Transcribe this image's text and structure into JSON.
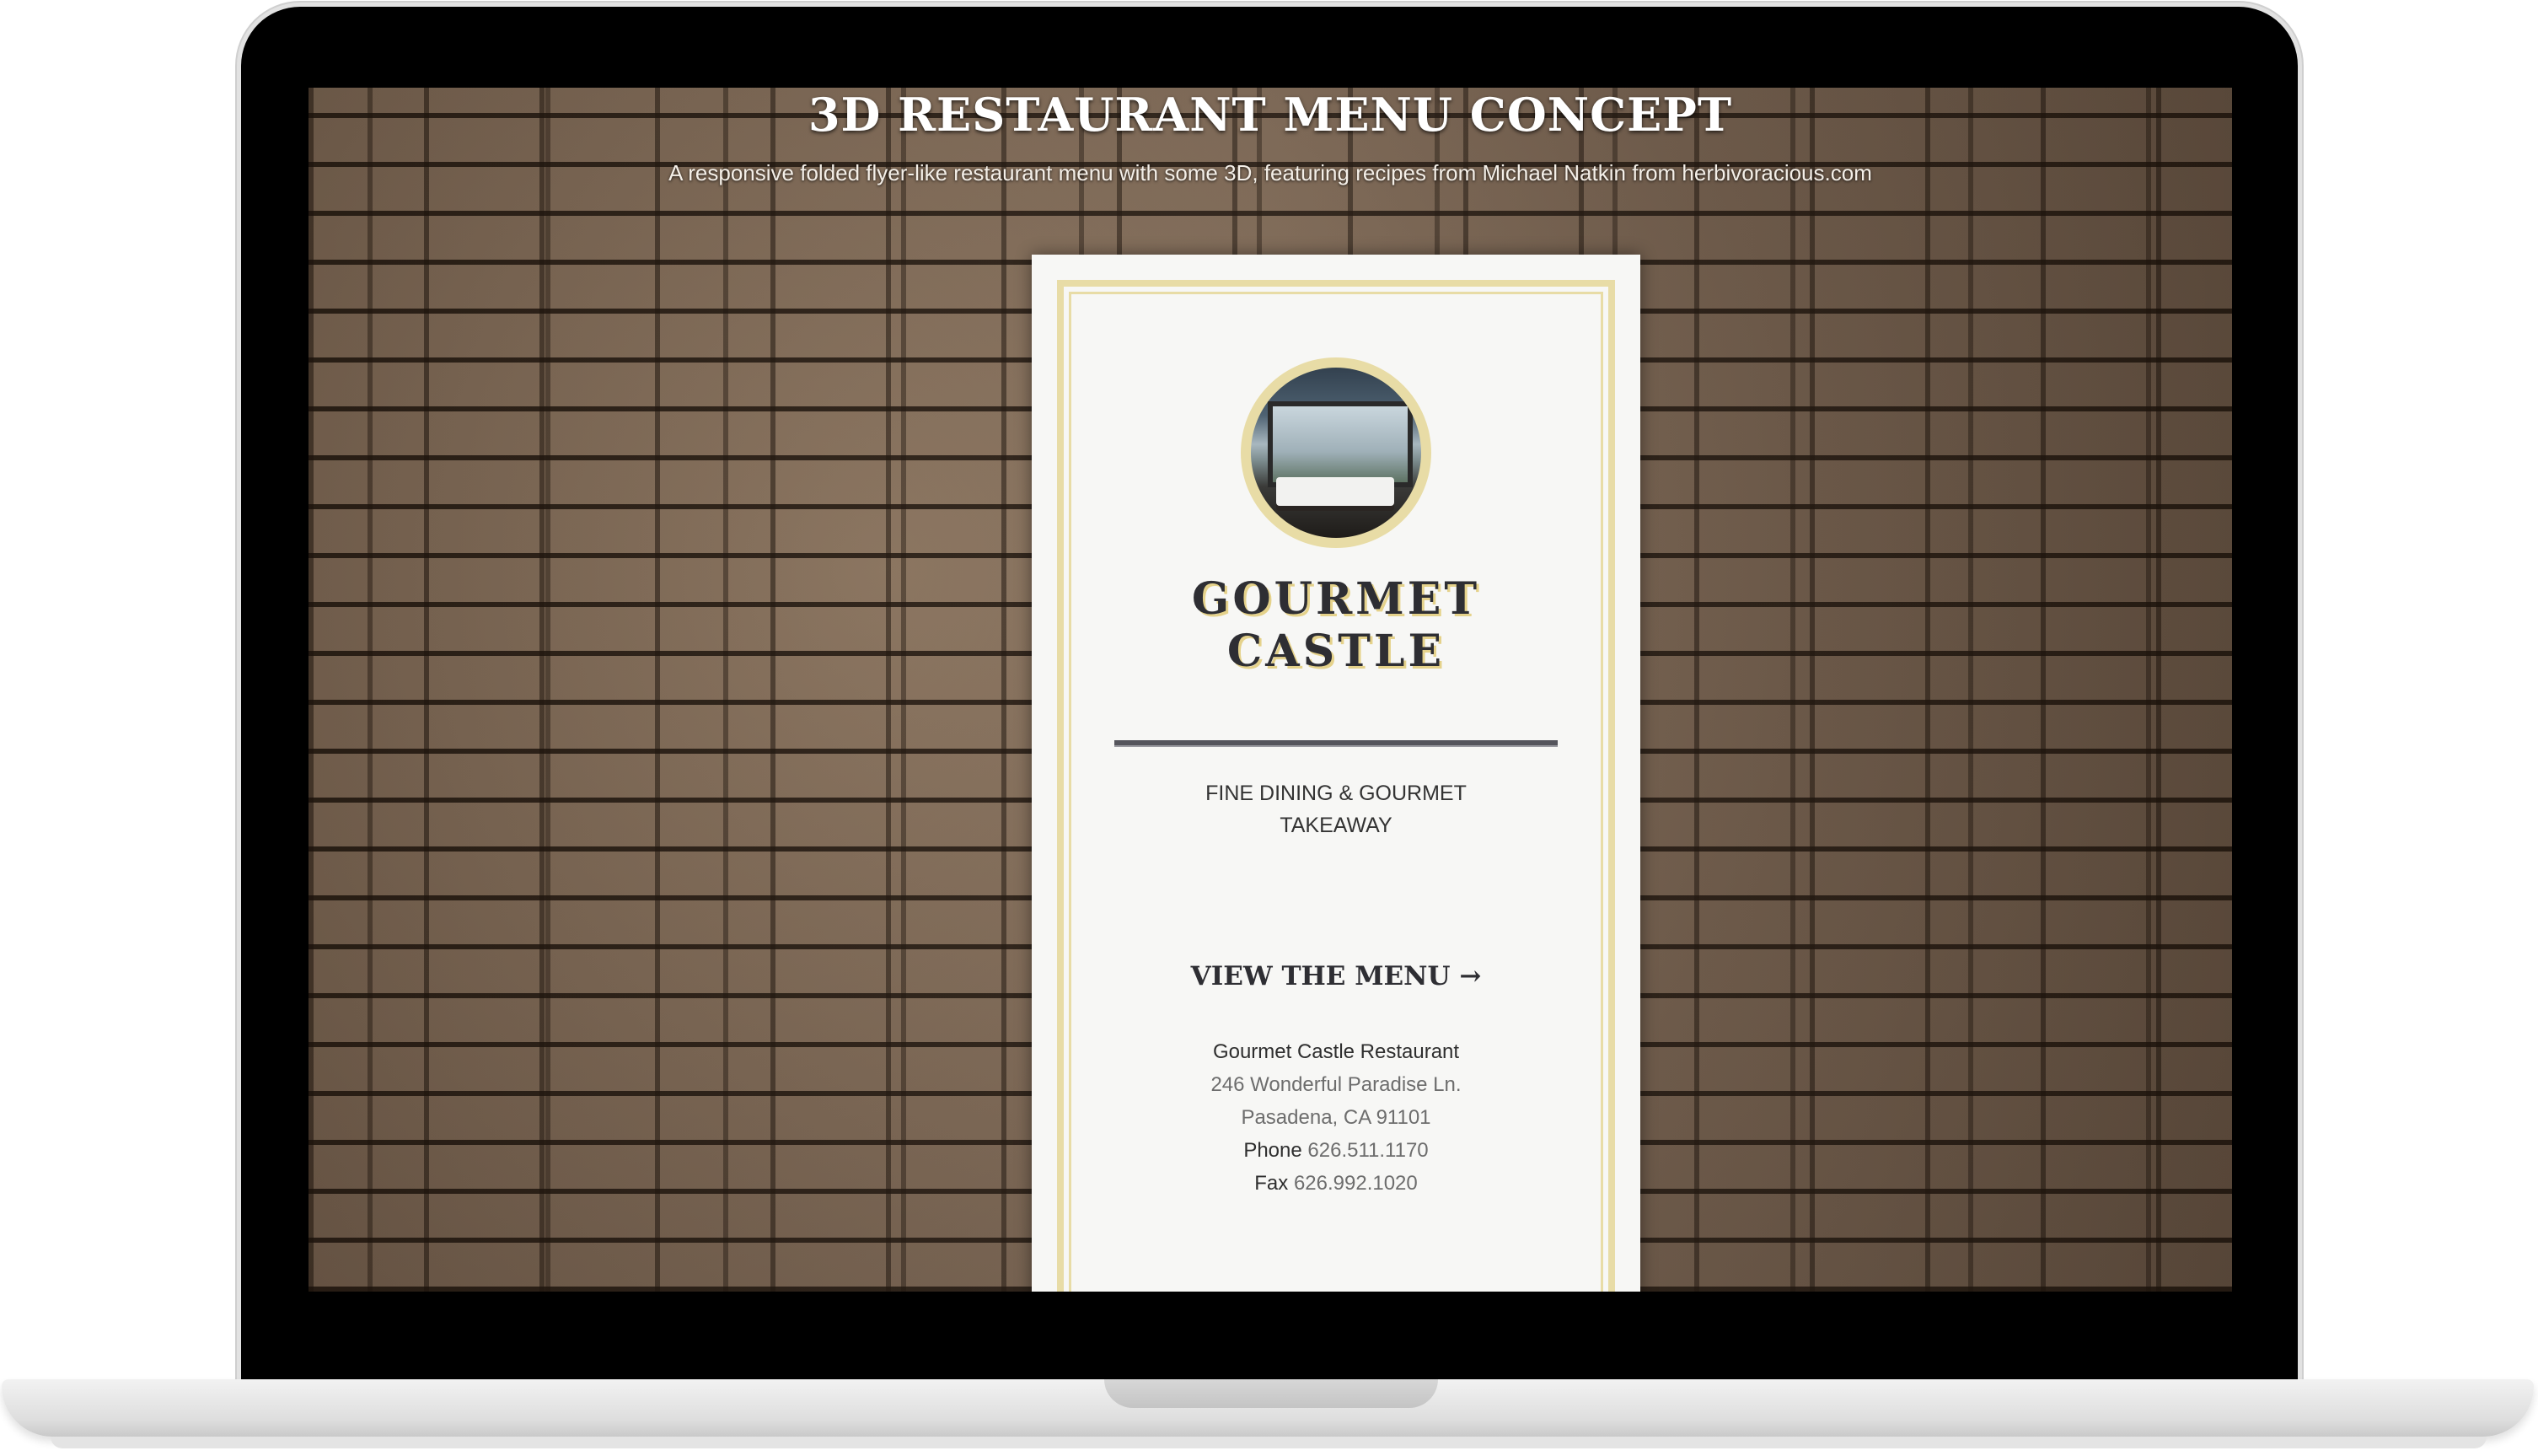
{
  "page": {
    "title": "3D RESTAURANT MENU CONCEPT",
    "subtitle": "A responsive folded flyer-like restaurant menu with some 3D, featuring recipes from Michael Natkin from herbivoracious.com"
  },
  "menu_card": {
    "name_line1": "GOURMET",
    "name_line2": "CASTLE",
    "tagline": "FINE DINING & GOURMET TAKEAWAY",
    "view_menu_label": "VIEW THE MENU",
    "view_menu_arrow": "→",
    "address": {
      "restaurant": "Gourmet Castle Restaurant",
      "street": "246 Wonderful Paradise Ln.",
      "city": "Pasadena, CA 91101",
      "phone_label": "Phone",
      "phone": "626.511.1170",
      "fax_label": "Fax",
      "fax": "626.992.1020"
    }
  },
  "colors": {
    "card_border": "#e8dca6",
    "title_text": "#2e2e33",
    "background_stone": "#7a6552"
  }
}
